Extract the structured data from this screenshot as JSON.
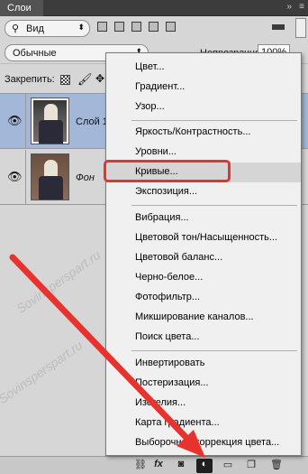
{
  "panel": {
    "tab_label": "Слои",
    "collapse_glyph": "»",
    "close_glyph": "≡"
  },
  "filter": {
    "kind_value": "Вид",
    "kind_icon": "search-icon"
  },
  "blend": {
    "mode_value": "Обычные",
    "opacity_label": "Непрозрачность:",
    "opacity_value": "100%"
  },
  "lock": {
    "label": "Закрепить:"
  },
  "layers": [
    {
      "name": "Слой 1",
      "selected": true,
      "italic": false
    },
    {
      "name": "Фон",
      "selected": false,
      "italic": true
    }
  ],
  "watermark": "Sovinsperspart.ru",
  "menu": {
    "items": [
      "Цвет...",
      "Градиент...",
      "Узор...",
      "Яркость/Контрастность...",
      "Уровни...",
      "Кривые...",
      "Экспозиция...",
      "Вибрация...",
      "Цветовой тон/Насыщенность...",
      "Цветовой баланс...",
      "Черно-белое...",
      "Фотофильтр...",
      "Микширование каналов...",
      "Поиск цвета...",
      "Инвертировать",
      "Постеризация...",
      "Изогелия...",
      "Карта градиента...",
      "Выборочная коррекция цвета..."
    ],
    "highlighted": "Кривые..."
  },
  "bottom_bar": {
    "icons": [
      "link-icon",
      "fx-icon",
      "mask-icon",
      "adjustment-layer-icon",
      "folder-icon",
      "new-layer-icon",
      "trash-icon"
    ],
    "fx_label": "fx"
  },
  "colors": {
    "highlight_box": "#e8322e",
    "selected_layer": "#a3b8d8"
  }
}
